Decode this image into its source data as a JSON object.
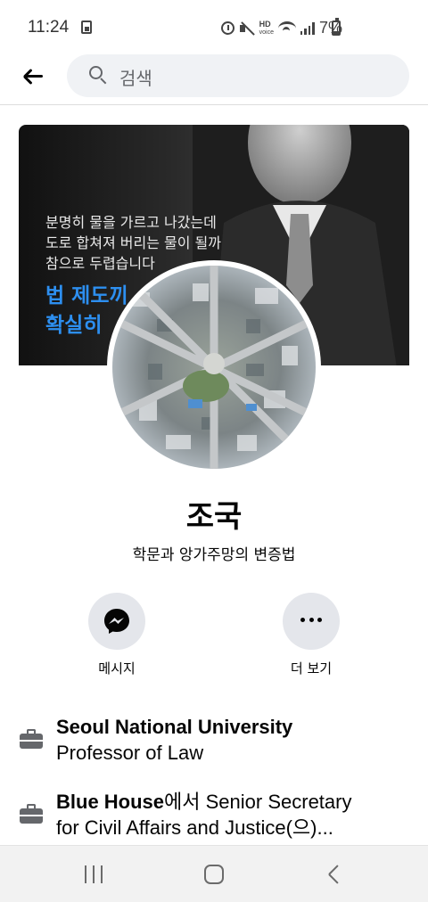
{
  "status_bar": {
    "time": "11:24",
    "hd_top": "HD",
    "hd_bottom": "voice",
    "battery": "7%"
  },
  "search": {
    "placeholder": "검색"
  },
  "cover": {
    "lines": [
      "분명히 물을 가르고 나갔는데",
      "도로 합쳐져 버리는 물이 될까",
      "참으로 두렵습니다"
    ],
    "bold_lines": [
      "법 제도끼",
      "확실히"
    ]
  },
  "profile": {
    "name": "조국",
    "bio": "학문과 앙가주망의 변증법"
  },
  "actions": {
    "message_label": "메시지",
    "more_label": "더 보기"
  },
  "info": [
    {
      "title": "Seoul National University",
      "subtitle": "Professor of Law"
    },
    {
      "title": "Blue House",
      "suffix": "에서 Senior Secretary",
      "line2": "for Civil Affairs and Justice(으)..."
    }
  ],
  "colors": {
    "accent": "#2d8ff0",
    "icon_gray": "#65676b",
    "button_bg": "#e4e6eb",
    "search_bg": "#f0f2f5"
  }
}
